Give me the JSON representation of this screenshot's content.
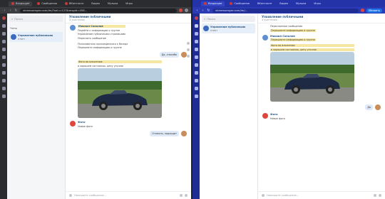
{
  "left": {
    "tabs": [
      {
        "label": "Входящие"
      },
      {
        "label": "Сообщения"
      },
      {
        "label": "ВКонтакте"
      },
      {
        "label": "Видео"
      },
      {
        "label": "Музыка"
      },
      {
        "label": "Игры"
      }
    ],
    "url": "vkmessenger.com/im/?sel=c123&msgid=456...",
    "search_placeholder": "Поиск",
    "sidebar_title": "Чаты",
    "dialog": {
      "name": "Управление публичными",
      "preview": "ответ"
    },
    "chat_title": "Управление публичными",
    "chat_subtitle": "3 участника",
    "messages": [
      {
        "author": "Михаил Соколов",
        "lines": [
          "Перейти к информации о группе",
          "Управление публичными страницами",
          "Переслать сообщение"
        ]
      },
      {
        "author": "",
        "lines": [
          "Пользователь присоединился к беседе",
          "Перешлите информацию о группе"
        ]
      },
      {
        "outgoing": "Да, спасибо"
      },
      {
        "author": "",
        "lines": [
          "Фото во вложении:",
          "в хорошем состоянии, цену уточню"
        ]
      },
      {
        "author": "Фото",
        "lines": [
          "Новое фото"
        ]
      },
      {
        "outgoing": "Отлично, подходит"
      }
    ],
    "composer_placeholder": "Напишите сообщение..."
  },
  "right": {
    "tabs": [
      {
        "label": "Входящие"
      },
      {
        "label": "Сообщения"
      },
      {
        "label": "ВКонтакте"
      },
      {
        "label": "Видео"
      },
      {
        "label": "Музыка"
      },
      {
        "label": "Игры"
      }
    ],
    "url": "vkmessenger.com/im/...",
    "update_label": "Обновить",
    "search_placeholder": "Поиск",
    "dialog": {
      "name": "Управление публичными",
      "preview": "ответ"
    },
    "chat_title": "Управление публичными",
    "chat_subtitle": "3 участника",
    "messages": [
      {
        "author": "",
        "lines": [
          "Пересланные сообщения",
          "Перешлите информацию о группе"
        ]
      },
      {
        "author": "Михаил Соколов",
        "lines": [
          "Перешлите информацию о группе"
        ]
      },
      {
        "author": "",
        "lines": [
          "Фото во вложении:",
          "в хорошем состоянии, цену уточню"
        ]
      },
      {
        "author": "Фото",
        "lines": [
          "Новое фото"
        ]
      },
      {
        "outgoing": "Да"
      }
    ],
    "composer_placeholder": "Напишите сообщение..."
  },
  "colors": {
    "left_chrome": "#3c3d41",
    "right_chrome": "#2b3bb5",
    "vk_blue": "#2a5885",
    "accent": "#1a73e8"
  }
}
